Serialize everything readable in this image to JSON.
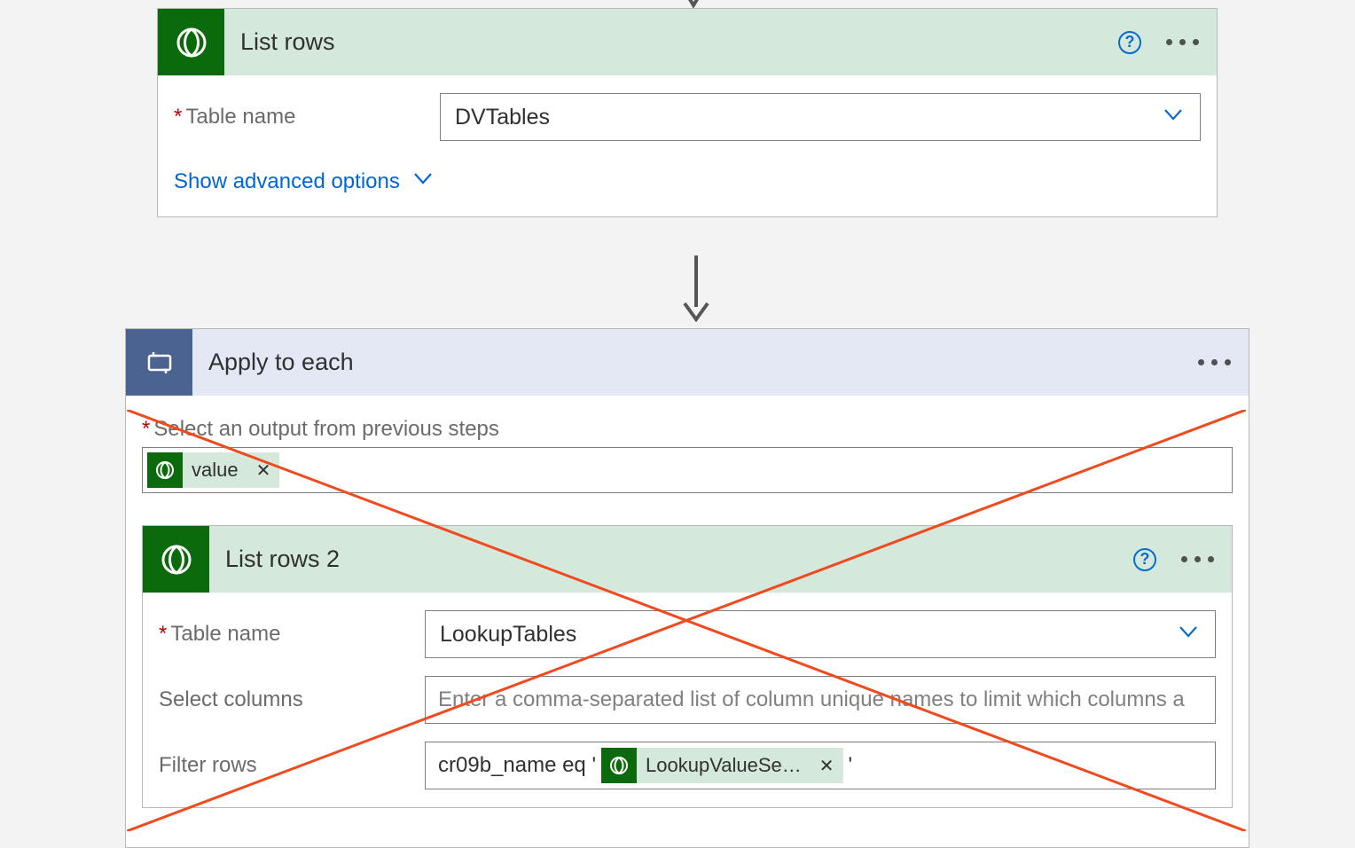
{
  "colors": {
    "green": "#0b6a0b",
    "headerGreen": "#d5e8dc",
    "applyBlue": "#4b6390",
    "applyHeader": "#e3e8f4",
    "link": "#0066d1",
    "helpBlue": "#0b6bcb",
    "cross": "#f04a1f"
  },
  "card1": {
    "title": "List rows",
    "tableName_label": "Table name",
    "tableName_value": "DVTables",
    "show_advanced": "Show advanced options"
  },
  "applyEach": {
    "title": "Apply to each",
    "select_output_label": "Select an output from previous steps",
    "output_chip": "value"
  },
  "card2": {
    "title": "List rows 2",
    "tableName_label": "Table name",
    "tableName_value": "LookupTables",
    "selectColumns_label": "Select columns",
    "selectColumns_placeholder": "Enter a comma-separated list of column unique names to limit which columns a",
    "filterRows_label": "Filter rows",
    "filterRows_prefix": "cr09b_name eq '",
    "filterRows_chip": "LookupValueSe…",
    "filterRows_suffix": "'"
  }
}
